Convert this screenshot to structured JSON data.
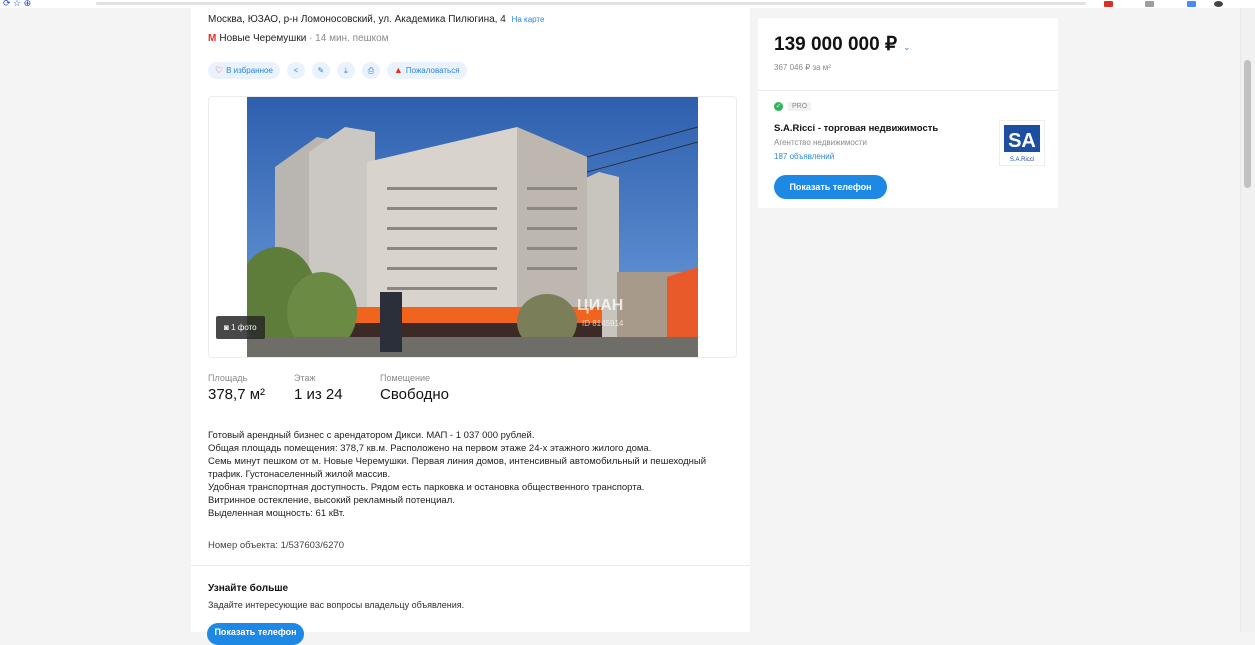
{
  "browser": {
    "toolbar_glyphs": "⟳ ☆ ⊕"
  },
  "listing": {
    "address": "Москва, ЮЗАО, р-н Ломоносовский, ул. Академика Пилюгина, 4",
    "map_link": "На карте",
    "metro_station": "Новые Черемушки",
    "metro_walk": "· 14 мин. пешком",
    "actions": {
      "favorite": "В избранное",
      "complain": "Пожаловаться"
    },
    "photo_count": "1 фото",
    "params": [
      {
        "label": "Площадь",
        "value": "378,7 м²"
      },
      {
        "label": "Этаж",
        "value": "1 из 24"
      },
      {
        "label": "Помещение",
        "value": "Свободно"
      }
    ],
    "description": [
      "Готовый арендный бизнес с арендатором Дикси. МАП - 1 037 000 рублей.",
      "Общая площадь помещения: 378,7 кв.м. Расположено на первом этаже 24-х этажного жилого дома.",
      "Семь минут пешком от м. Новые Черемушки. Первая линия домов, интенсивный автомобильный и пешеходный трафик. Густонаселенный жилой массив.",
      "Удобная транспортная доступность. Рядом есть парковка и остановка общественного транспорта.",
      "Витринное остекление, высокий рекламный потенциал.",
      "Выделенная мощность: 61 кВт."
    ],
    "object_number": "Номер объекта: 1/537603/6270",
    "learn_more": {
      "title": "Узнайте больше",
      "subtitle": "Задайте интересующие вас вопросы владельцу объявления.",
      "button": "Показать телефон"
    },
    "watermark": "ЦИАН",
    "watermark_id": "ID 8145914"
  },
  "sidebar": {
    "price": "139 000 000 ₽",
    "price_per_m2": "367 046 ₽ за м²",
    "pro": "PRO",
    "agency_name": "S.A.Ricci - торговая недвижимость",
    "agency_type": "Агентство недвижимости",
    "agency_count": "187 объявлений",
    "logo_text": "S.A.Ricci",
    "show_phone": "Показать телефон"
  },
  "colors": {
    "accent": "#1e88e5",
    "link": "#2b87db",
    "metro": "#e8301c"
  }
}
